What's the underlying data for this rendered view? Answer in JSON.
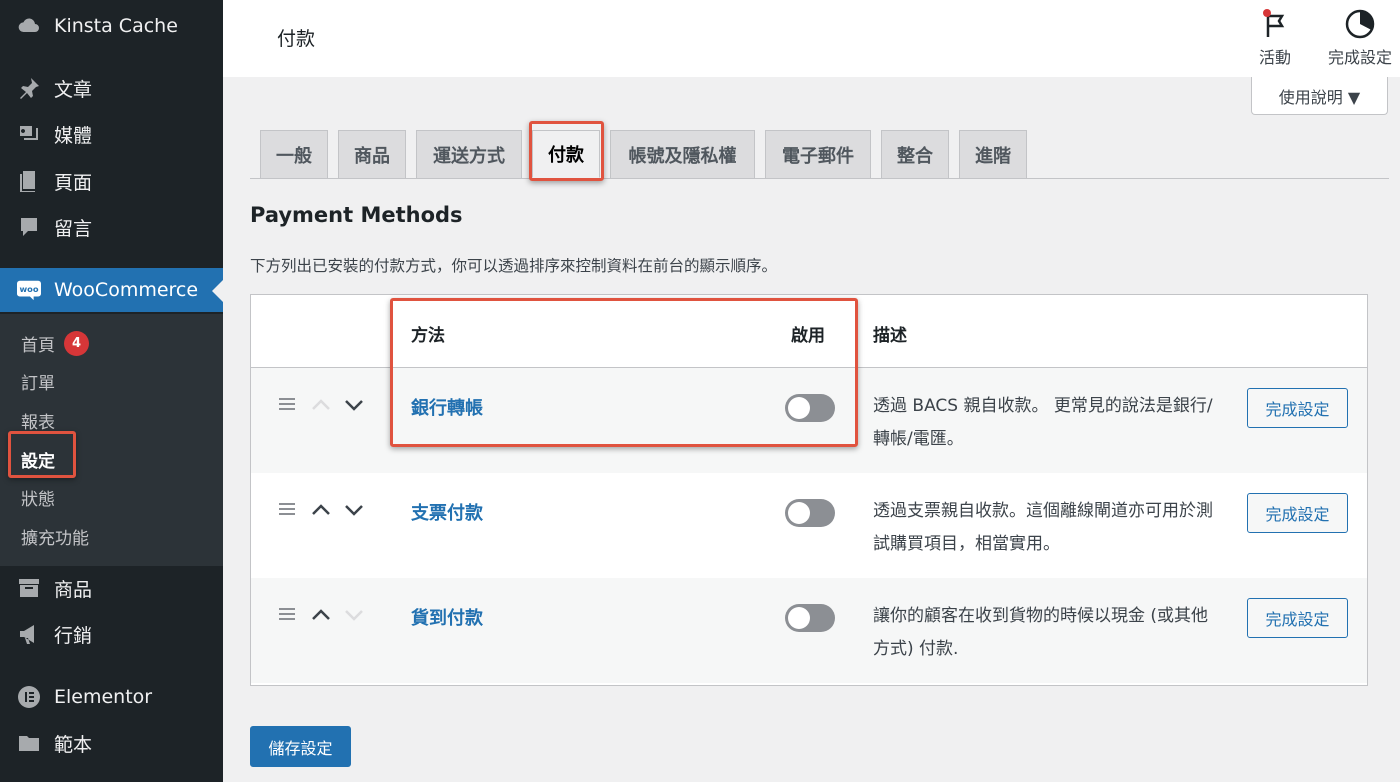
{
  "sidebar": {
    "items": [
      {
        "label": "Kinsta Cache",
        "icon": "cloud-icon"
      },
      {
        "label": "文章",
        "icon": "pin-icon"
      },
      {
        "label": "媒體",
        "icon": "media-icon"
      },
      {
        "label": "頁面",
        "icon": "page-icon"
      },
      {
        "label": "留言",
        "icon": "comment-icon"
      },
      {
        "label": "WooCommerce",
        "icon": "woo-icon"
      },
      {
        "label": "商品",
        "icon": "archive-icon"
      },
      {
        "label": "行銷",
        "icon": "megaphone-icon"
      },
      {
        "label": "Elementor",
        "icon": "elementor-icon"
      },
      {
        "label": "範本",
        "icon": "folder-icon"
      }
    ],
    "woo_logo_text": "woo",
    "submenu": [
      {
        "label": "首頁",
        "badge": "4"
      },
      {
        "label": "訂單"
      },
      {
        "label": "報表"
      },
      {
        "label": "設定",
        "current": true
      },
      {
        "label": "狀態"
      },
      {
        "label": "擴充功能"
      }
    ]
  },
  "header": {
    "title": "付款",
    "activity_label": "活動",
    "setup_label": "完成設定",
    "help_label": "使用說明 ▼"
  },
  "tabs": [
    {
      "label": "一般"
    },
    {
      "label": "商品"
    },
    {
      "label": "運送方式"
    },
    {
      "label": "付款",
      "active": true
    },
    {
      "label": "帳號及隱私權"
    },
    {
      "label": "電子郵件"
    },
    {
      "label": "整合"
    },
    {
      "label": "進階"
    }
  ],
  "section": {
    "title": "Payment Methods",
    "description": "下方列出已安裝的付款方式，你可以透過排序來控制資料在前台的顯示順序。"
  },
  "table": {
    "headers": {
      "method": "方法",
      "enabled": "啟用",
      "description": "描述"
    },
    "rows": [
      {
        "method": "銀行轉帳",
        "enabled": false,
        "description": "透過 BACS 親自收款。 更常見的說法是銀行/轉帳/電匯。",
        "button": "完成設定"
      },
      {
        "method": "支票付款",
        "enabled": false,
        "description": "透過支票親自收款。這個離線閘道亦可用於測試購買項目，相當實用。",
        "button": "完成設定"
      },
      {
        "method": "貨到付款",
        "enabled": false,
        "description": "讓你的顧客在收到貨物的時候以現金 (或其他方式) 付款.",
        "button": "完成設定"
      }
    ]
  },
  "save_label": "儲存設定",
  "colors": {
    "sidebar_bg": "#1d2327",
    "accent": "#2271b1",
    "highlight_box": "#e0533f",
    "badge": "#d63638"
  }
}
